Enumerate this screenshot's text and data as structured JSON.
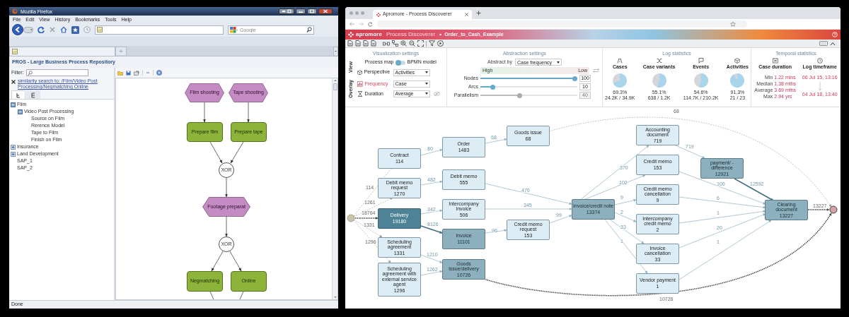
{
  "firefox": {
    "title": "Mozilla Firefox",
    "menu": [
      "File",
      "Edit",
      "View",
      "History",
      "Bookmarks",
      "Tools",
      "Help"
    ],
    "search_placeholder": "Google",
    "status": "Done"
  },
  "pros": {
    "title": "PROS - Large Business Process Repository",
    "filter_label": "Filter:",
    "similarity_link": "similarity search to: /Film/Video Post Processing/Negmatching Online",
    "view_tabs": [
      {
        "selected": true
      },
      {
        "selected": false
      }
    ],
    "tree": [
      {
        "label": "Film",
        "expanded": true,
        "children": [
          {
            "label": "Video Post Processing",
            "expanded": true,
            "children": [
              {
                "label": "Source on Film"
              },
              {
                "label": "Rerence Model"
              },
              {
                "label": "Tape to Film"
              },
              {
                "label": "Finish on Film"
              }
            ]
          }
        ]
      },
      {
        "label": "Insurance",
        "expanded": false
      },
      {
        "label": "Land Development",
        "expanded": false
      },
      {
        "label": "SAP_1"
      },
      {
        "label": "SAP_2"
      }
    ],
    "diagram_nodes": [
      {
        "kind": "event",
        "label": "Film shooting"
      },
      {
        "kind": "event",
        "label": "Tape shooting"
      },
      {
        "kind": "function",
        "label": "Prepare film"
      },
      {
        "kind": "function",
        "label": "Prepare tape"
      },
      {
        "kind": "connector",
        "label": "XOR"
      },
      {
        "kind": "event",
        "label": "Footage preparat"
      },
      {
        "kind": "connector",
        "label": "XOR"
      },
      {
        "kind": "function",
        "label": "Negmatching"
      },
      {
        "kind": "function",
        "label": "Online"
      }
    ]
  },
  "apromore": {
    "tab_title": "Apromore - Process Discoverer",
    "brand": "apromore",
    "app": "Process Discoverer",
    "log_name": "Order_to_Cash_Example",
    "viz": {
      "title": "Visualization settings",
      "view_label": "View",
      "process_map": "Process map",
      "bpmn_model": "BPMN model",
      "bpmn_on": false,
      "perspective_label": "Perspective",
      "perspective": "Activities",
      "overlay_label": "Overlay",
      "overlays": [
        {
          "label": "Frequency",
          "value": "Case",
          "selected": true
        },
        {
          "label": "Duration",
          "value": "Average",
          "selected": false
        }
      ]
    },
    "abstraction": {
      "title": "Abstraction settings",
      "abstract_by_label": "Abstract by",
      "abstract_by": "Case frequency",
      "high": "High",
      "low": "Low",
      "sliders": [
        {
          "label": "Nodes",
          "level": 1,
          "value": "100",
          "disabled": false
        },
        {
          "label": "Arcs",
          "level": 0.11,
          "value": "10",
          "disabled": false
        },
        {
          "label": "Parallelism",
          "level": 0.4,
          "value": "40",
          "disabled": true
        }
      ]
    },
    "log_stats": {
      "title": "Log statistics",
      "items": [
        {
          "label": "Cases",
          "percent": "69.3%",
          "count": "24.2K / 34.9K"
        },
        {
          "label": "Case variants",
          "percent": "55.1%",
          "count": "638 / 1.2K"
        },
        {
          "label": "Events",
          "percent": "54.6%",
          "count": "114.7K / 210.2K"
        },
        {
          "label": "Activities",
          "percent": "91.3%",
          "count": "21 / 23"
        }
      ]
    },
    "temporal": {
      "title": "Temporal statistics",
      "case_duration_label": "Case duration",
      "rows": [
        {
          "label": "Min",
          "value": "1.22 mins"
        },
        {
          "label": "Median",
          "value": "1.38 mths"
        },
        {
          "label": "Average",
          "value": "3.69 mths"
        },
        {
          "label": "Max",
          "value": "2.94 yrs"
        }
      ],
      "timeframe_label": "Log timeframe",
      "start": "06 Jul 15, 13:16",
      "end": "04 Jul 18, 13:40"
    },
    "map": {
      "nodes": [
        {
          "label": "Contract",
          "count": "114",
          "kind": "light"
        },
        {
          "label": "Order",
          "count": "1483",
          "kind": "light"
        },
        {
          "label": "Goods issue",
          "count": "68",
          "kind": "light"
        },
        {
          "label": "Debit memo request",
          "count": "1270",
          "kind": "light"
        },
        {
          "label": "Debit memo",
          "count": "555",
          "kind": "light"
        },
        {
          "label": "Delivery",
          "count": "19180",
          "kind": "dark"
        },
        {
          "label": "Intercompany invoice",
          "count": "506",
          "kind": "light"
        },
        {
          "label": "Invoice",
          "count": "11101",
          "kind": "medium"
        },
        {
          "label": "Credit memo request",
          "count": "153",
          "kind": "light"
        },
        {
          "label": "Scheduling agreement",
          "count": "1331",
          "kind": "light"
        },
        {
          "label": "Scheduling agreement with external service agent",
          "count": "1296",
          "kind": "light"
        },
        {
          "label": "Goods issue/delivery",
          "count": "10726",
          "kind": "medium"
        },
        {
          "label": "Invoice/credit note",
          "count": "13374",
          "kind": "medium"
        },
        {
          "label": "Accounting document",
          "count": "719",
          "kind": "light"
        },
        {
          "label": "Credit memo",
          "count": "153",
          "kind": "light"
        },
        {
          "label": "Credit memo cancellation",
          "count": "9",
          "kind": "light"
        },
        {
          "label": "Intercompany credit memo",
          "count": "2",
          "kind": "light"
        },
        {
          "label": "Invoice cancellation",
          "count": "33",
          "kind": "light"
        },
        {
          "label": "Vendor payment",
          "count": "1",
          "kind": "light"
        },
        {
          "label": "payment/ -difference",
          "count": "12921",
          "kind": "medium"
        },
        {
          "label": "Clearing document",
          "count": "13227",
          "kind": "medium"
        }
      ],
      "edges": [
        {
          "label": "114",
          "kind": "dashed"
        },
        {
          "label": "1261",
          "kind": "dashed"
        },
        {
          "label": "18764",
          "kind": "heavy_dashed"
        },
        {
          "label": "1331",
          "kind": "dashed"
        },
        {
          "label": "1296",
          "kind": "dashed"
        },
        {
          "label": "80",
          "kind": "arc"
        },
        {
          "label": "68",
          "kind": "arc"
        },
        {
          "label": "482",
          "kind": "arc"
        },
        {
          "label": "470",
          "kind": "arc"
        },
        {
          "label": "342",
          "kind": "arc"
        },
        {
          "label": "345",
          "kind": "arc"
        },
        {
          "label": "8126",
          "kind": "strong"
        },
        {
          "label": "96",
          "kind": "arc"
        },
        {
          "label": "99",
          "kind": "arc"
        },
        {
          "label": "1210",
          "kind": "arc"
        },
        {
          "label": "1262",
          "kind": "arc"
        },
        {
          "label": "68",
          "kind": "dashed"
        },
        {
          "label": "10726",
          "kind": "heavy_dashed"
        },
        {
          "label": "370",
          "kind": "arc"
        },
        {
          "label": "102",
          "kind": "arc"
        },
        {
          "label": "9",
          "kind": "arc"
        },
        {
          "label": "2",
          "kind": "arc"
        },
        {
          "label": "33",
          "kind": "arc"
        },
        {
          "label": "1",
          "kind": "arc"
        },
        {
          "label": "719",
          "kind": "arc"
        },
        {
          "label": "100",
          "kind": "arc"
        },
        {
          "label": "6",
          "kind": "arc"
        },
        {
          "label": "1",
          "kind": "arc"
        },
        {
          "label": "20",
          "kind": "arc"
        },
        {
          "label": "1",
          "kind": "arc"
        },
        {
          "label": "12592",
          "kind": "strong"
        },
        {
          "label": "13227",
          "kind": "heavy_dashed"
        }
      ]
    }
  }
}
